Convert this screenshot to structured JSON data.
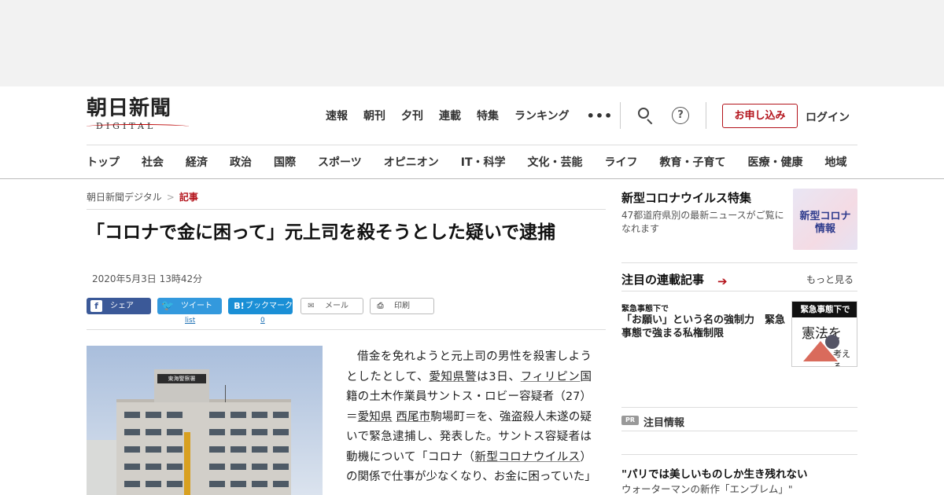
{
  "header": {
    "logo_main": "朝日新聞",
    "logo_sub": "DIGITAL",
    "top_nav": [
      "速報",
      "朝刊",
      "夕刊",
      "連載",
      "特集",
      "ランキング"
    ],
    "more_glyph": "•••",
    "help_glyph": "?",
    "subscribe_label": "お申し込み",
    "login_label": "ログイン",
    "brand_color": "#b3121a"
  },
  "category_nav": [
    "トップ",
    "社会",
    "経済",
    "政治",
    "国際",
    "スポーツ",
    "オピニオン",
    "IT・科学",
    "文化・芸能",
    "ライフ",
    "教育・子育て",
    "医療・健康",
    "地域"
  ],
  "breadcrumb": {
    "home": "朝日新聞デジタル",
    "separator": ">",
    "current": "記事"
  },
  "article": {
    "headline": "「コロナで金に困って」元上司を殺そうとした疑いで逮捕",
    "date": "2020年5月3日 13時42分",
    "photo_sign": "東海警察署",
    "body_parts": [
      {
        "t": "借金を免れようと元上司の男性を殺害しようとしたとして、"
      },
      {
        "t": "愛知県警",
        "link": true
      },
      {
        "t": "は3日、"
      },
      {
        "t": "フィリピン",
        "link": true
      },
      {
        "t": "国籍の土木作業員サントス・ロビー容疑者（27）＝"
      },
      {
        "t": "愛知県",
        "link": true
      },
      {
        "t": " "
      },
      {
        "t": "西尾市",
        "link": true
      },
      {
        "t": "駒場町＝を、強盗殺人未遂の疑いで緊急逮捕し、発表した。サントス容疑者は動機について「コロナ（"
      },
      {
        "t": "新型コロナウイルス",
        "link": true
      },
      {
        "t": "）の関係で仕事が少なくなり、お金に困っていた」"
      }
    ]
  },
  "share": {
    "facebook": {
      "icon": "f",
      "label": "シェア"
    },
    "twitter": {
      "icon": "🐦",
      "label": "ツイート",
      "count": "list"
    },
    "hatena": {
      "icon": "B!",
      "label": "ブックマーク",
      "count": "0"
    },
    "mail": {
      "icon": "✉",
      "label": "メール"
    },
    "print": {
      "icon": "⎙",
      "label": "印刷"
    }
  },
  "sidebar": {
    "corona": {
      "title": "新型コロナウイルス特集",
      "desc": "47都道府県別の最新ニュースがご覧になれます",
      "thumb_text": "新型コロナ情報"
    },
    "series": {
      "title": "注目の連載記事",
      "arrow": "➔",
      "more": "もっと見る",
      "tag": "緊急事態下で",
      "item_title": "「お願い」という名の強制力　緊急事態で強まる私権制限",
      "thumb_band": "緊急事態下で",
      "thumb_text1": "憲法を",
      "thumb_text2": "考える"
    },
    "pr": {
      "badge": "PR",
      "label": "注目情報",
      "ad_title": "\"パリでは美しいものしか生き残れない",
      "ad_sub": "ウォーターマンの新作「エンブレム」\""
    }
  }
}
